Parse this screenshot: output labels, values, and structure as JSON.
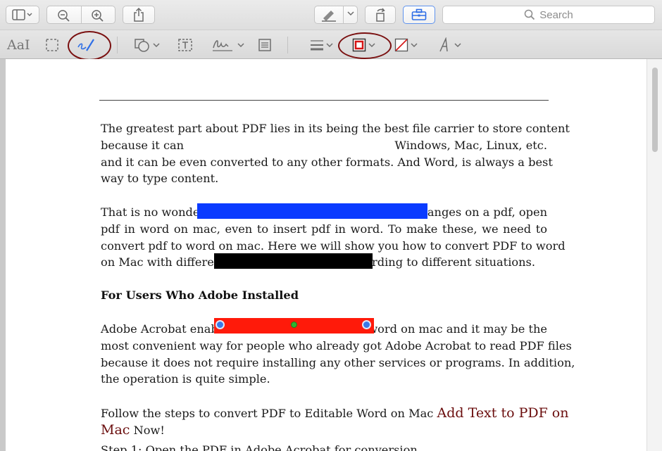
{
  "toolbar": {
    "search_placeholder": "Search",
    "text_style_label": "AaI"
  },
  "colors": {
    "highlight_circle": "#7a1010",
    "blue_redaction": "#0a3bff",
    "black_redaction": "#000000",
    "red_redaction": "#ff1a0a",
    "link": "#6a0d0d"
  },
  "document": {
    "p1": [
      "The greatest part about PDF lies in its being the best file carrier to store content",
      "because it can",
      "Windows, Mac, Linux, etc.",
      "and it can be even converted to any other formats. And Word, is always a best",
      "way to type content."
    ],
    "p2": [
      "That is no wonde",
      "changes on a pdf, open",
      "pdf in word on mac, even to insert pdf in word. To make these, we need to",
      "convert pdf to word on mac. Here we will show you how to convert PDF to word",
      "on Mac with differen",
      "rding to different situations."
    ],
    "heading": "For Users Who Adobe Installed",
    "p3": [
      "Adobe Acrobat enab",
      "word on mac and it may be the",
      "most convenient way for people who already got Adobe Acrobat to read PDF files",
      "because it does not require installing any other services or programs. In addition,",
      "the operation is quite simple."
    ],
    "p4": {
      "lead": "Follow the steps to convert PDF to Editable Word on Mac",
      "link_part1": "Add Text to PDF on",
      "link_part2": "Mac",
      "tail": "Now!"
    },
    "p5": "Step 1: Open the PDF in Adobe Acrobat for conversion"
  }
}
